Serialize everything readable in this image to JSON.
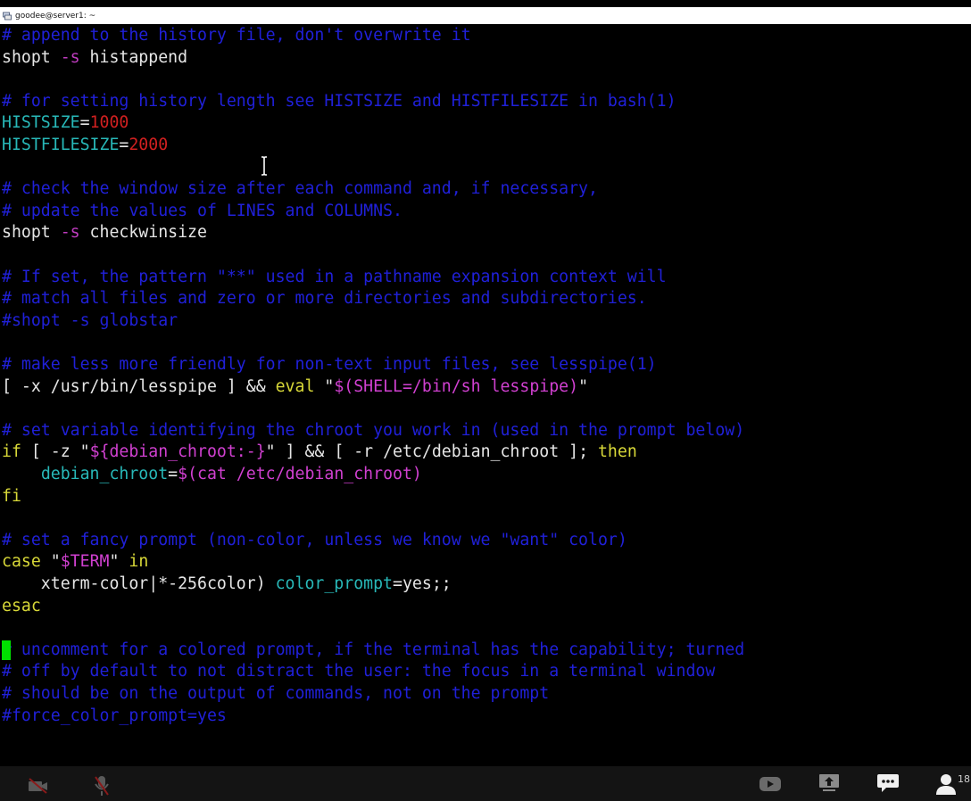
{
  "window": {
    "title": "goodee@server1: ~"
  },
  "terminal": {
    "lines": [
      [
        [
          "# append to the history file, don't overwrite it",
          "comment"
        ]
      ],
      [
        [
          "shopt ",
          "plain"
        ],
        [
          "-s",
          "flag"
        ],
        [
          " histappend",
          "plain"
        ]
      ],
      [],
      [
        [
          "# for setting history length see HISTSIZE and HISTFILESIZE in bash(1)",
          "comment"
        ]
      ],
      [
        [
          "HISTSIZE",
          "var"
        ],
        [
          "=",
          "plain"
        ],
        [
          "1000",
          "num"
        ]
      ],
      [
        [
          "HISTFILESIZE",
          "var"
        ],
        [
          "=",
          "plain"
        ],
        [
          "2000",
          "num"
        ]
      ],
      [],
      [
        [
          "# check the window size after each command and, if necessary,",
          "comment"
        ]
      ],
      [
        [
          "# update the values of LINES and COLUMNS.",
          "comment"
        ]
      ],
      [
        [
          "shopt ",
          "plain"
        ],
        [
          "-s",
          "flag"
        ],
        [
          " checkwinsize",
          "plain"
        ]
      ],
      [],
      [
        [
          "# If set, the pattern \"**\" used in a pathname expansion context will",
          "comment"
        ]
      ],
      [
        [
          "# match all files and zero or more directories and subdirectories.",
          "comment"
        ]
      ],
      [
        [
          "#shopt -s globstar",
          "comment"
        ]
      ],
      [],
      [
        [
          "# make less more friendly for non-text input files, see lesspipe(1)",
          "comment"
        ]
      ],
      [
        [
          "[ -x /usr/bin/lesspipe ] && ",
          "plain"
        ],
        [
          "eval",
          "eval"
        ],
        [
          " \"",
          "plain"
        ],
        [
          "$(SHELL=/bin/sh lesspipe)",
          "str"
        ],
        [
          "\"",
          "plain"
        ]
      ],
      [],
      [
        [
          "# set variable identifying the chroot you work in (used in the prompt below)",
          "comment"
        ]
      ],
      [
        [
          "if",
          "kw"
        ],
        [
          " [ -z \"",
          "plain"
        ],
        [
          "${debian_chroot:-}",
          "str"
        ],
        [
          "\" ] && [ -r /etc/debian_chroot ]; ",
          "plain"
        ],
        [
          "then",
          "kw"
        ]
      ],
      [
        [
          "    ",
          "plain"
        ],
        [
          "debian_chroot",
          "var"
        ],
        [
          "=",
          "plain"
        ],
        [
          "$(cat /etc/debian_chroot)",
          "str"
        ]
      ],
      [
        [
          "fi",
          "kw"
        ]
      ],
      [],
      [
        [
          "# set a fancy prompt (non-color, unless we know we \"want\" color)",
          "comment"
        ]
      ],
      [
        [
          "case",
          "kw"
        ],
        [
          " \"",
          "plain"
        ],
        [
          "$TERM",
          "str"
        ],
        [
          "\" ",
          "plain"
        ],
        [
          "in",
          "kw"
        ]
      ],
      [
        [
          "    xterm-color|*-256color) ",
          "plain"
        ],
        [
          "color_prompt",
          "var"
        ],
        [
          "=yes;;",
          "plain"
        ]
      ],
      [
        [
          "esac",
          "kw"
        ]
      ],
      [],
      [
        [
          "# uncomment for a colored prompt, if the terminal has the capability; turned",
          "comment"
        ]
      ],
      [
        [
          "# off by default to not distract the user: the focus in a terminal window",
          "comment"
        ]
      ],
      [
        [
          "# should be on the output of commands, not on the prompt",
          "comment"
        ]
      ],
      [
        [
          "#force_color_prompt=yes",
          "comment"
        ]
      ]
    ],
    "cursor_line": 28
  },
  "meeting_bar": {
    "participant_count": "18",
    "icons": [
      "camera-off-icon",
      "mic-off-icon",
      "video-share-icon",
      "screen-share-icon",
      "chat-icon",
      "participants-icon"
    ]
  },
  "colors": {
    "comment": "#2020d8",
    "plain": "#e6e6e6",
    "variable": "#28b8b8",
    "number": "#d02020",
    "flag": "#c03cc0",
    "string": "#d040d0",
    "keyword": "#d8d838",
    "cursor": "#00e000"
  }
}
